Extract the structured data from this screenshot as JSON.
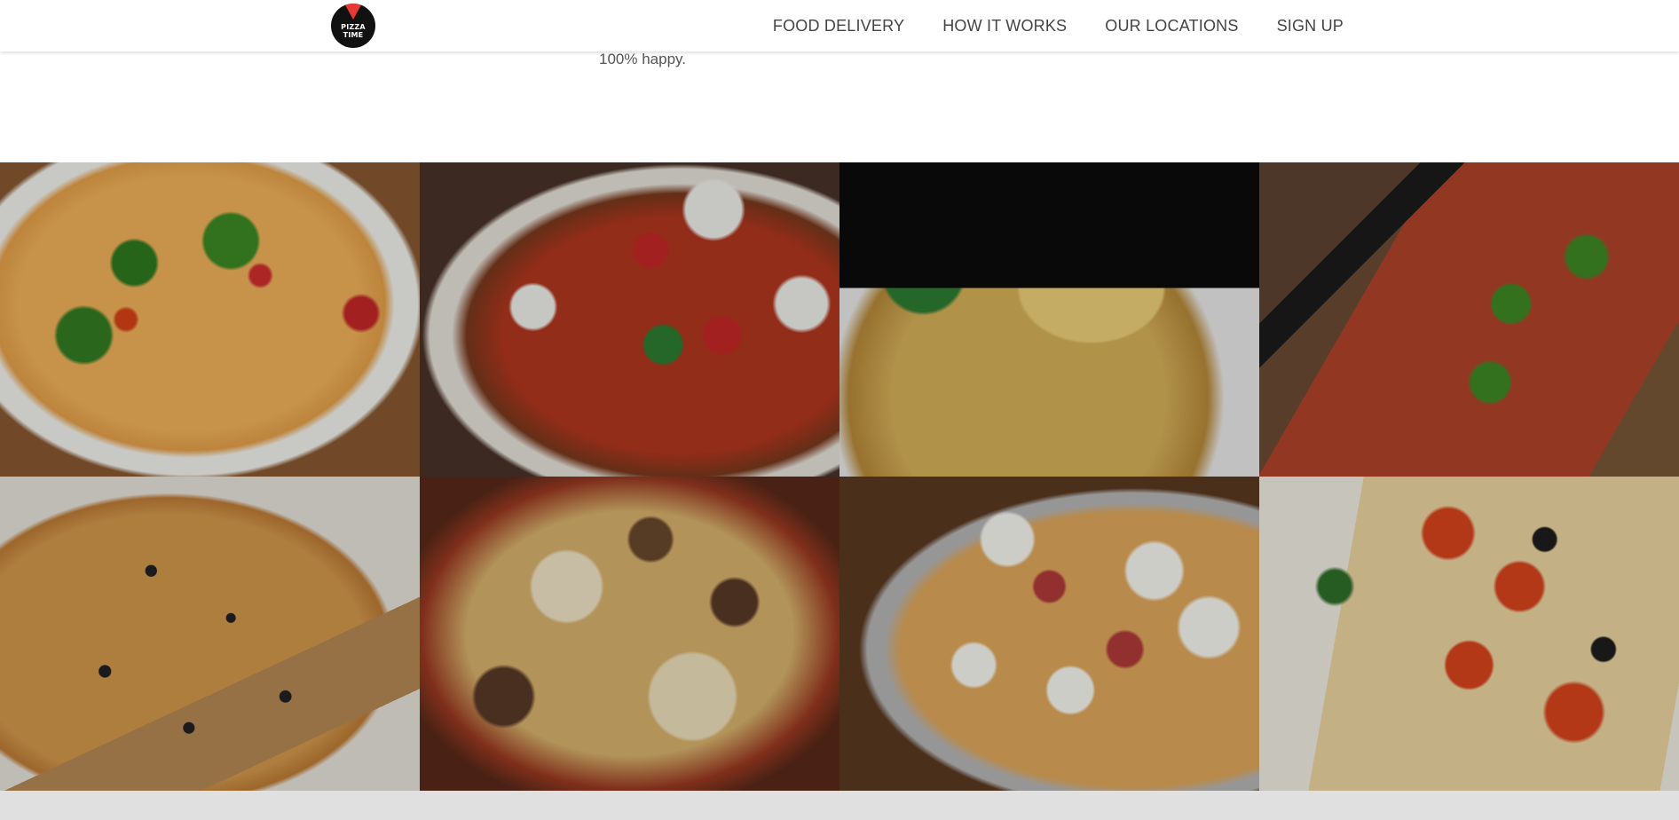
{
  "brand": {
    "logo_text_line1": "PIZZA",
    "logo_text_line2": "TIME",
    "accent_color": "#e53935"
  },
  "nav": {
    "links": [
      {
        "label": "FOOD DELIVERY"
      },
      {
        "label": "HOW IT WORKS"
      },
      {
        "label": "OUR LOCATIONS"
      },
      {
        "label": "SIGN UP"
      }
    ]
  },
  "features": {
    "col2_last_line": "100% happy."
  },
  "gallery": {
    "tiles": [
      {
        "name": "arugula-tomato-pizza"
      },
      {
        "name": "margherita-pizza"
      },
      {
        "name": "cheesy-slice-pizza"
      },
      {
        "name": "rectangular-arugula-pizza"
      },
      {
        "name": "olive-rosemary-pizza"
      },
      {
        "name": "mushroom-cheese-pizza"
      },
      {
        "name": "egg-salami-pizza"
      },
      {
        "name": "tomato-tart-pizza"
      }
    ]
  }
}
